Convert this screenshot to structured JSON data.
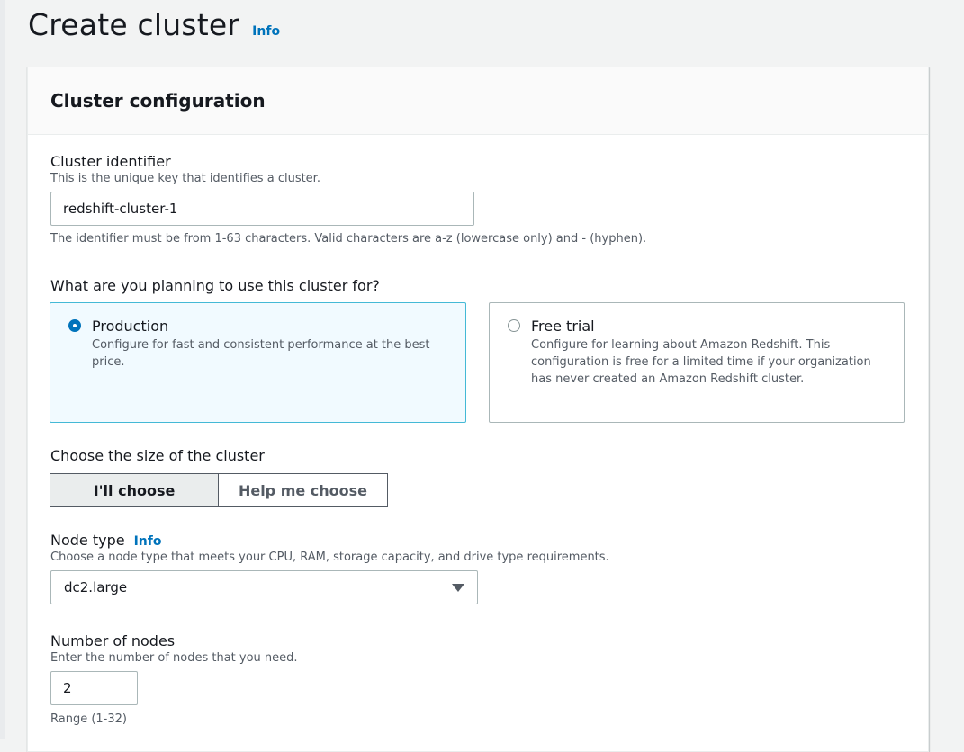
{
  "page": {
    "title": "Create cluster",
    "info": "Info"
  },
  "panel": {
    "title": "Cluster configuration"
  },
  "cluster_identifier": {
    "label": "Cluster identifier",
    "description": "This is the unique key that identifies a cluster.",
    "value": "redshift-cluster-1",
    "constraint": "The identifier must be from 1-63 characters. Valid characters are a-z (lowercase only) and - (hyphen)."
  },
  "usage": {
    "label": "What are you planning to use this cluster for?",
    "options": [
      {
        "title": "Production",
        "description": "Configure for fast and consistent performance at the best price.",
        "selected": true
      },
      {
        "title": "Free trial",
        "description": "Configure for learning about Amazon Redshift. This configuration is free for a limited time if your organization has never created an Amazon Redshift cluster.",
        "selected": false
      }
    ]
  },
  "size": {
    "label": "Choose the size of the cluster",
    "options": [
      "I'll choose",
      "Help me choose"
    ],
    "selected": "I'll choose"
  },
  "node_type": {
    "label": "Node type",
    "info": "Info",
    "description": "Choose a node type that meets your CPU, RAM, storage capacity, and drive type requirements.",
    "value": "dc2.large"
  },
  "nodes": {
    "label": "Number of nodes",
    "description": "Enter the number of nodes that you need.",
    "value": "2",
    "constraint": "Range (1-32)"
  },
  "colors": {
    "link": "#0073bb",
    "selected_border": "#44b9d6",
    "selected_bg": "#f1faff"
  },
  "icons": {
    "radio_selected": "radio-checked-icon",
    "radio_unselected": "radio-unchecked-icon",
    "dropdown": "caret-down-icon"
  }
}
